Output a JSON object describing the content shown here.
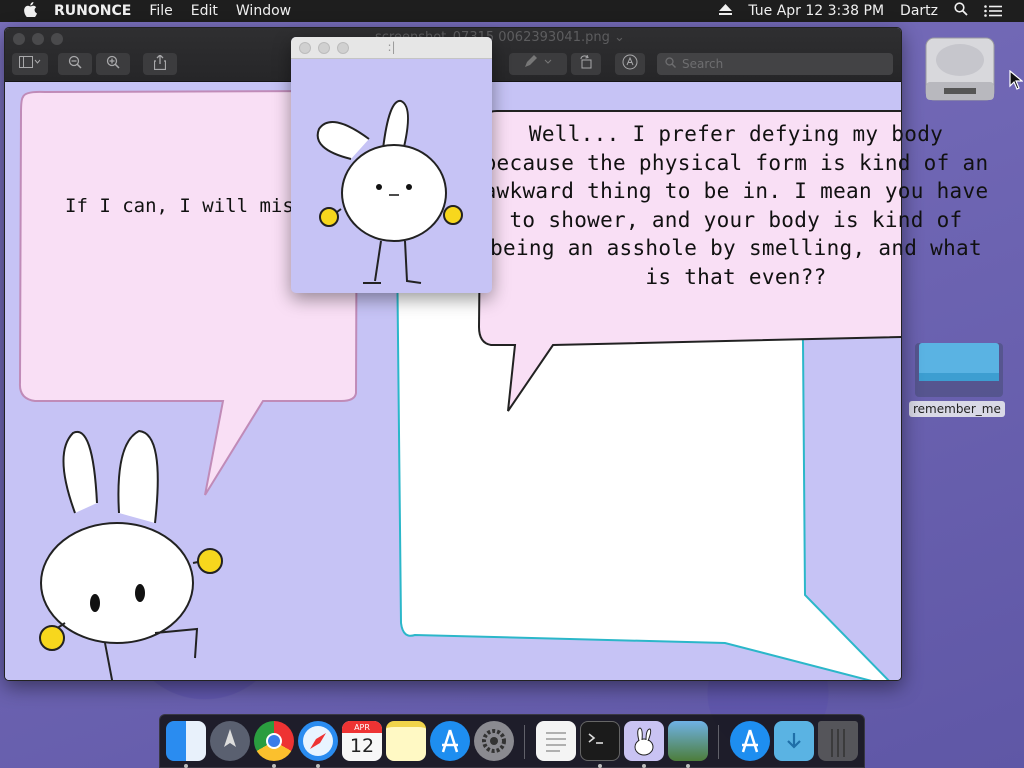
{
  "menubar": {
    "apple": "",
    "app_name": "RUNONCE",
    "menus": [
      "File",
      "Edit",
      "Window"
    ],
    "date_time": "Tue Apr 12  3:38 PM",
    "user": "Dartz"
  },
  "preview_window": {
    "title": "screenshot_07315 0062393041.png ⌄",
    "search_placeholder": "Search"
  },
  "small_window": {
    "title": ":|"
  },
  "comic": {
    "left_bubble_text": "If I can, I will miss you",
    "right_bubble_text": "Well... I prefer defying my body because the physical form is kind of an awkward thing to be in. I mean you have to shower, and your body is kind of being an asshole by smelling, and what is that even??"
  },
  "desktop": {
    "folder_label": "remember_me"
  },
  "dock": {
    "calendar_month": "APR",
    "calendar_day": "12",
    "items": [
      "finder",
      "launchpad",
      "chrome",
      "safari",
      "calendar",
      "notes",
      "app-store",
      "system-preferences",
      "textedit",
      "terminal",
      "bunny-app",
      "preview",
      "app-store-2",
      "downloads",
      "trash"
    ]
  },
  "colors": {
    "canvas": "#c6c3f5",
    "pink_bubble": "#f9dff5",
    "desktop": "#6f66b3"
  }
}
